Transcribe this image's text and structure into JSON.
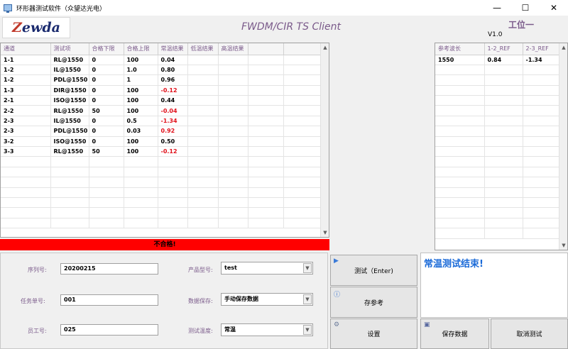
{
  "window": {
    "title": "环形器测试软件（众望达光电）",
    "controls": [
      "—",
      "☐",
      "✕"
    ]
  },
  "header": {
    "logo_text_z": "Z",
    "logo_text_rest": "ewda",
    "app_title": "FWDM/CIR TS Client",
    "station": "工位一",
    "version": "V1.0"
  },
  "results_table": {
    "columns": [
      "通道",
      "测试项",
      "合格下限",
      "合格上限",
      "常温结果",
      "低温结果",
      "高温结果"
    ],
    "rows": [
      {
        "ch": "1-1",
        "item": "RL@1550",
        "lo": "0",
        "hi": "100",
        "room": "0.04",
        "low": "",
        "high": "",
        "fail": false
      },
      {
        "ch": "1-2",
        "item": "IL@1550",
        "lo": "0",
        "hi": "1.0",
        "room": "0.80",
        "low": "",
        "high": "",
        "fail": false
      },
      {
        "ch": "1-2",
        "item": "PDL@1550",
        "lo": "0",
        "hi": "1",
        "room": "0.96",
        "low": "",
        "high": "",
        "fail": false
      },
      {
        "ch": "1-3",
        "item": "DIR@1550",
        "lo": "0",
        "hi": "100",
        "room": "-0.12",
        "low": "",
        "high": "",
        "fail": true
      },
      {
        "ch": "2-1",
        "item": "ISO@1550",
        "lo": "0",
        "hi": "100",
        "room": "0.44",
        "low": "",
        "high": "",
        "fail": false
      },
      {
        "ch": "2-2",
        "item": "RL@1550",
        "lo": "50",
        "hi": "100",
        "room": "-0.04",
        "low": "",
        "high": "",
        "fail": true
      },
      {
        "ch": "2-3",
        "item": "IL@1550",
        "lo": "0",
        "hi": "0.5",
        "room": "-1.34",
        "low": "",
        "high": "",
        "fail": true
      },
      {
        "ch": "2-3",
        "item": "PDL@1550",
        "lo": "0",
        "hi": "0.03",
        "room": "0.92",
        "low": "",
        "high": "",
        "fail": true
      },
      {
        "ch": "3-2",
        "item": "ISO@1550",
        "lo": "0",
        "hi": "100",
        "room": "0.50",
        "low": "",
        "high": "",
        "fail": false
      },
      {
        "ch": "3-3",
        "item": "RL@1550",
        "lo": "50",
        "hi": "100",
        "room": "-0.12",
        "low": "",
        "high": "",
        "fail": true
      }
    ]
  },
  "ref_table": {
    "columns": [
      "参考波长",
      "1-2_REF",
      "2-3_REF"
    ],
    "rows": [
      {
        "wl": "1550",
        "r12": "0.84",
        "r23": "-1.34"
      }
    ]
  },
  "result_banner": "不合格!",
  "form": {
    "serial_label": "序列号:",
    "serial_value": "20200215",
    "order_label": "任务单号:",
    "order_value": "001",
    "employee_label": "员工号:",
    "employee_value": "025",
    "model_label": "产品型号:",
    "model_value": "test",
    "save_label": "数据保存:",
    "save_value": "手动保存数据",
    "temp_label": "测试温度:",
    "temp_value": "常温"
  },
  "buttons": {
    "test": "测试（Enter)",
    "save_ref": "存参考",
    "settings": "设置",
    "save_data": "保存数据",
    "cancel_test": "取消测试"
  },
  "status_message": "常温测试结束!",
  "colors": {
    "fail_text": "#e0101a",
    "banner_fail": "#ff0000",
    "status_text": "#1a6ad8",
    "label_purple": "#7a5a8a"
  }
}
